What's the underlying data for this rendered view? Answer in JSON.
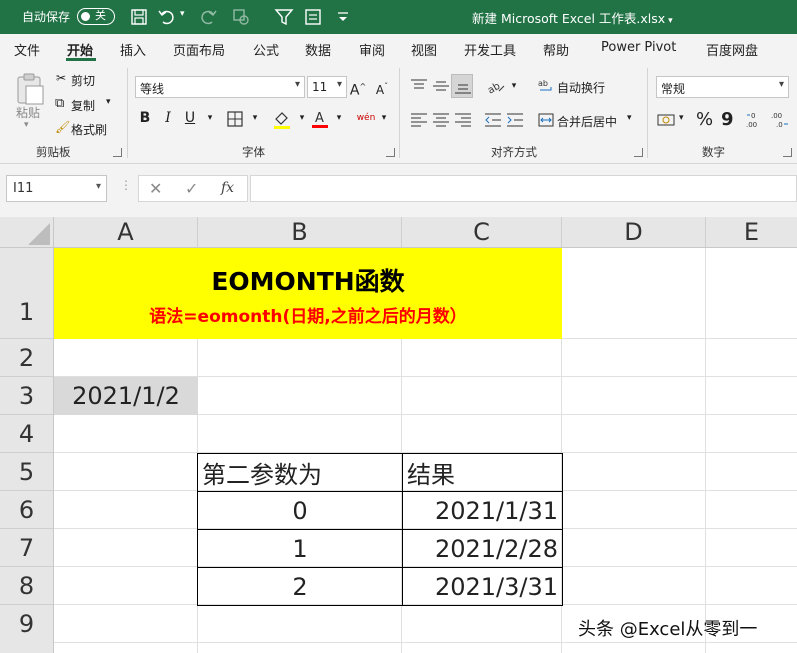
{
  "titlebar": {
    "autosave_label": "自动保存",
    "autosave_state": "关",
    "doc_title": "新建 Microsoft Excel 工作表.xlsx",
    "doc_title_caret": "▾"
  },
  "ribbon_tabs": [
    "文件",
    "开始",
    "插入",
    "页面布局",
    "公式",
    "数据",
    "审阅",
    "视图",
    "开发工具",
    "帮助",
    "Power Pivot",
    "百度网盘"
  ],
  "active_tab": "开始",
  "clipboard": {
    "paste": "粘贴",
    "cut": "剪切",
    "copy": "复制",
    "format_painter": "格式刷",
    "group": "剪贴板"
  },
  "font_group": {
    "font_name": "等线",
    "font_size": "11",
    "bold": "B",
    "italic": "I",
    "underline": "U",
    "group": "字体"
  },
  "alignment": {
    "wrap_text": "自动换行",
    "merge_center": "合并后居中",
    "group": "对齐方式"
  },
  "number": {
    "format": "常规",
    "percent": "%",
    "comma": "9",
    "group": "数字"
  },
  "formula_bar": {
    "name_box": "I11",
    "cancel": "✕",
    "enter": "✓",
    "fx": "fx",
    "formula": ""
  },
  "columns": [
    "A",
    "B",
    "C",
    "D",
    "E"
  ],
  "rows": [
    "1",
    "2",
    "3",
    "4",
    "5",
    "6",
    "7",
    "8",
    "9"
  ],
  "sheet": {
    "banner_title": "EOMONTH函数",
    "banner_syntax": "语法=eomonth(日期,之前之后的月数）",
    "a3": "2021/1/2",
    "table_header": [
      "第二参数为",
      "结果"
    ],
    "table_rows": [
      [
        "0",
        "2021/1/31"
      ],
      [
        "1",
        "2021/2/28"
      ],
      [
        "2",
        "2021/3/31"
      ]
    ]
  },
  "watermark": "头条 @Excel从零到一",
  "colors": {
    "title_bar": "#217346",
    "banner_fill": "#ffff00",
    "syntax_text": "#ff0000",
    "a3_fill": "#d9d9d9"
  }
}
